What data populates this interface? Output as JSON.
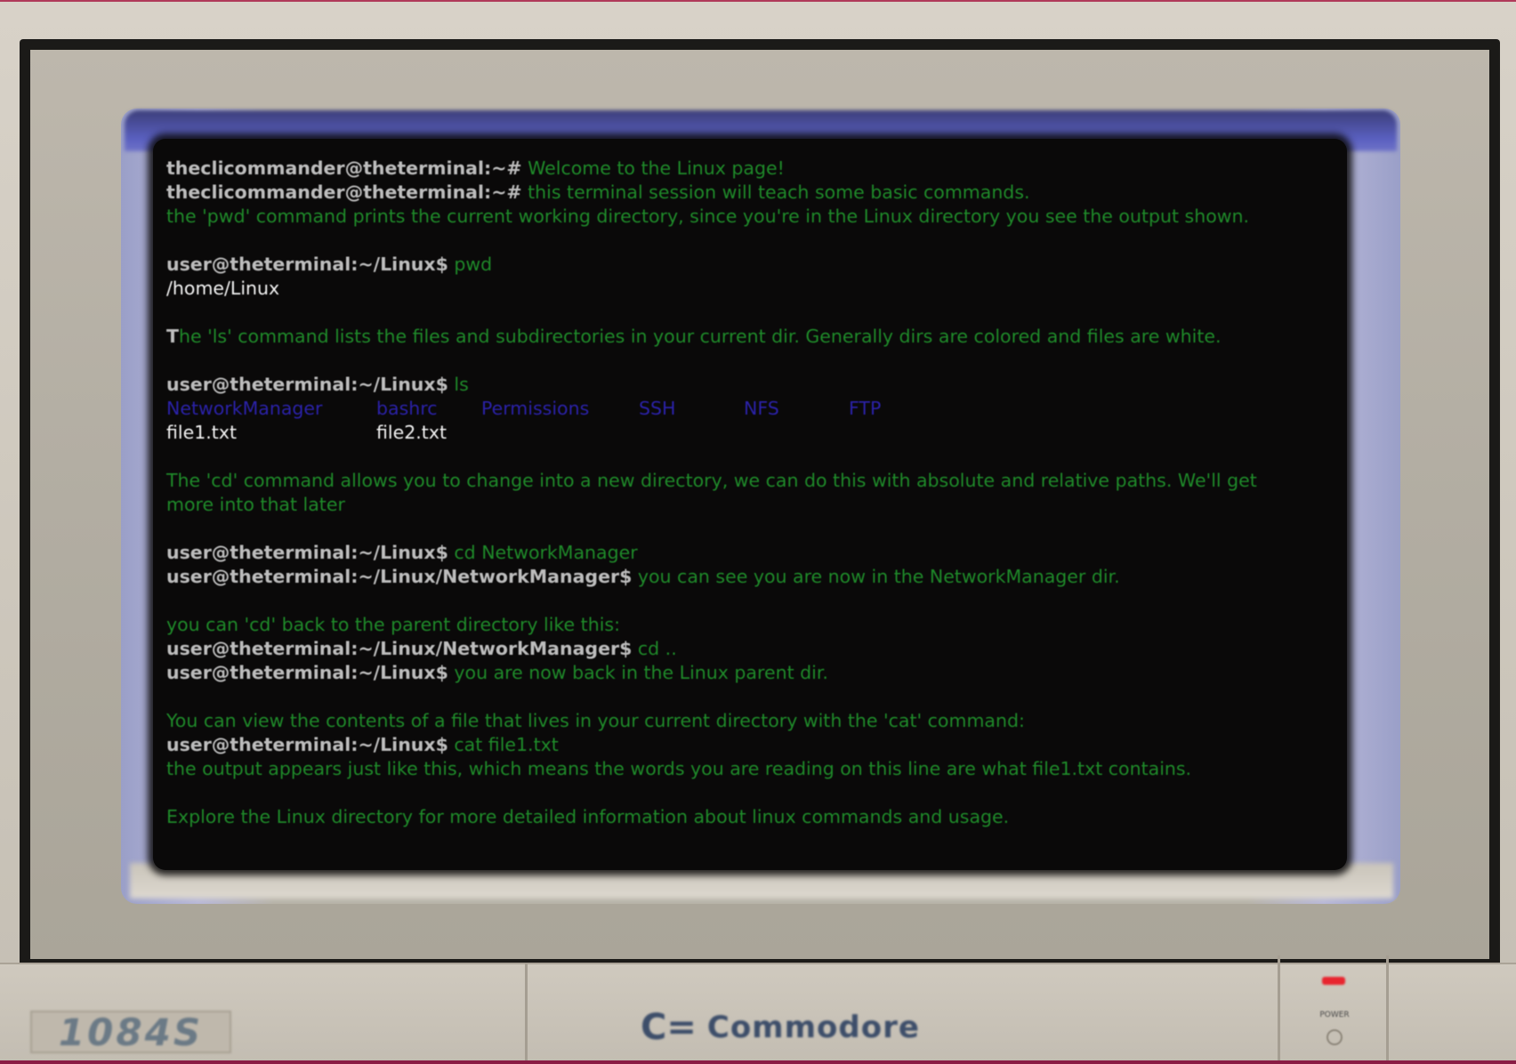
{
  "terminal": {
    "lines": [
      {
        "prompt": "theclicommander@theterminal:~#",
        "text": " Welcome to the Linux page!"
      },
      {
        "prompt": "theclicommander@theterminal:~#",
        "text": " this terminal session will teach some basic commands."
      },
      {
        "text": "the 'pwd' command prints the current working directory, since you're in the Linux directory you see the output shown."
      },
      {
        "prompt": "user@theterminal:~/Linux$",
        "text": " pwd"
      },
      {
        "output": "/home/Linux"
      },
      {
        "highlight": "T",
        "text": "he 'ls' command lists the files and subdirectories in your current dir. Generally dirs are colored and files are white."
      },
      {
        "prompt": "user@theterminal:~/Linux$",
        "text": " ls"
      },
      {
        "dirs": [
          "NetworkManager",
          "bashrc",
          "Permissions",
          "SSH",
          "NFS",
          "FTP"
        ]
      },
      {
        "files": [
          "file1.txt",
          "file2.txt"
        ]
      },
      {
        "text": "The 'cd' command allows you to change into a new directory, we can do this with absolute and relative paths. We'll get"
      },
      {
        "text": "more into that later"
      },
      {
        "prompt": "user@theterminal:~/Linux$",
        "text": " cd NetworkManager"
      },
      {
        "prompt": "user@theterminal:~/Linux/NetworkManager$",
        "text": " you can see you are now in the NetworkManager dir."
      },
      {
        "text": "you can 'cd' back to the parent directory like this:"
      },
      {
        "prompt": "user@theterminal:~/Linux/NetworkManager$",
        "text": " cd .."
      },
      {
        "prompt": "user@theterminal:~/Linux$",
        "text": " you are now back in the Linux parent dir."
      },
      {
        "text": "You can view the contents of a file that lives in your current directory with the 'cat' command:"
      },
      {
        "prompt": "user@theterminal:~/Linux$",
        "text": " cat file1.txt"
      },
      {
        "text": "the output appears just like this, which means the words you are reading on this line are what file1.txt contains."
      },
      {
        "text": "Explore the Linux directory for more detailed information about linux commands and usage."
      }
    ]
  },
  "monitor": {
    "model": "1084S",
    "brand_logo": "C=",
    "brand": "Commodore",
    "power_label": "POWER"
  },
  "colors": {
    "terminal_bg": "#0a0909",
    "prompt": "#bdbdbd",
    "text_green": "#1f8a2a",
    "dir_blue": "#2b22a8",
    "file_white": "#f2f2f2",
    "power_led": "#e8252f"
  }
}
